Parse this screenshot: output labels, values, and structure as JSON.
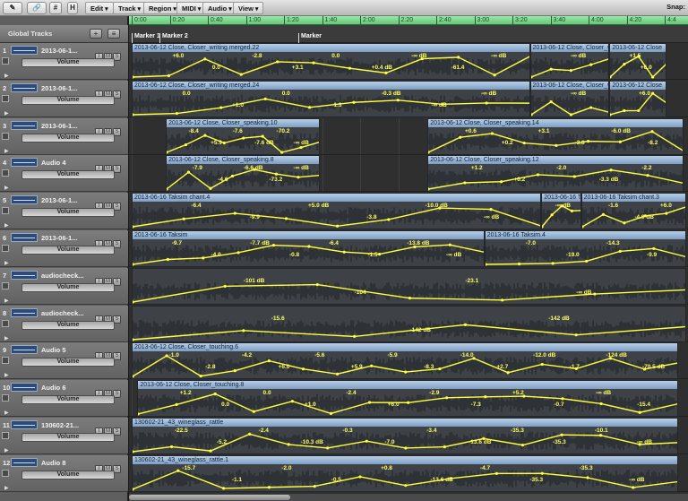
{
  "toolbar": {
    "buttons": [
      "✎",
      "🔗",
      "#",
      "H"
    ],
    "menus": [
      "Edit",
      "Track",
      "Region",
      "MIDI",
      "Audio",
      "View"
    ],
    "snap_label": "Snap:"
  },
  "global_tracks": {
    "label": "Global Tracks",
    "add": "+"
  },
  "ruler": {
    "ticks": [
      "0:00",
      "0:20",
      "0:40",
      "1:00",
      "1:20",
      "1:40",
      "2:00",
      "2:20",
      "2:40",
      "3:00",
      "3:20",
      "3:40",
      "4:00",
      "4:20",
      "4:4"
    ]
  },
  "markers": [
    {
      "label": "Marker 1",
      "pos": 0
    },
    {
      "label": "Marker 2",
      "pos": 0.5
    },
    {
      "label": "Marker",
      "pos": 3.0
    }
  ],
  "tracks": [
    {
      "num": "1",
      "name": "2013-06-1...",
      "param": "Volume",
      "regions": [
        {
          "title": "2013-06-12 Close, Closer_writing merged.22",
          "start": 0,
          "end": 3.5,
          "labels": [
            "+6.0",
            "0.0",
            "-2.8",
            "+3.1",
            "0.0",
            "+0.4 dB",
            "-∞ dB",
            "-61.4",
            "-∞ dB"
          ]
        },
        {
          "title": "2013-06-12 Close, Closer_writing me",
          "start": 3.5,
          "end": 4.2,
          "labels": [
            "-∞ dB"
          ]
        },
        {
          "title": "2013-06-12 Close",
          "start": 4.2,
          "end": 4.7,
          "labels": [
            "+1.5",
            "+6.0"
          ]
        }
      ]
    },
    {
      "num": "2",
      "name": "2013-06-1...",
      "param": "Volume",
      "regions": [
        {
          "title": "2013-06-12 Close, Closer_writing merged.24",
          "start": 0,
          "end": 3.5,
          "labels": [
            "0.0",
            "+1.0",
            "0.0",
            "-1.3",
            "-0.3 dB",
            "-∞ dB",
            "-∞ dB"
          ]
        },
        {
          "title": "2013-06-12 Close, Closer_writ",
          "start": 3.5,
          "end": 4.2,
          "labels": [
            "-∞ dB"
          ]
        },
        {
          "title": "2013-06-12 Close",
          "start": 4.2,
          "end": 4.7,
          "labels": [
            "+6.0"
          ]
        }
      ]
    },
    {
      "num": "3",
      "name": "2013-06-1...",
      "param": "Volume",
      "regions": [
        {
          "title": "2013-06-12 Close, Closer_speaking.10",
          "start": 0.3,
          "end": 1.65,
          "labels": [
            "-8.4",
            "+5.9",
            "-7.6",
            "-7.6 dB",
            "-70.2",
            "-∞ dB"
          ]
        },
        {
          "title": "2013-06-12 Close, Closer_speaking.14",
          "start": 2.6,
          "end": 4.85,
          "labels": [
            "+0.6",
            "+0.2",
            "+3.1",
            "-3.8",
            "-6.0 dB",
            "-8.2"
          ]
        }
      ]
    },
    {
      "num": "4",
      "name": "Audio 4",
      "param": "Volume",
      "regions": [
        {
          "title": "2013-06-12 Close, Closer_speaking.8",
          "start": 0.3,
          "end": 1.65,
          "labels": [
            "-7.9",
            "-4.6",
            "-6.6 dB",
            "-73.2",
            "-∞ dB"
          ]
        },
        {
          "title": "2013-06-12 Close, Closer_speaking.12",
          "start": 2.6,
          "end": 4.85,
          "labels": [
            "+1.2",
            "+0.2",
            "-2.0",
            "-3.3 dB",
            "-2.2"
          ]
        }
      ]
    },
    {
      "num": "5",
      "name": "2013-06-1...",
      "param": "Volume",
      "regions": [
        {
          "title": "2013-06-16 Taksim chant.4",
          "start": 0,
          "end": 3.6,
          "labels": [
            "-6.4",
            "-9.9",
            "+5.0 dB",
            "-3.8",
            "-10.0 dB",
            "-∞ dB"
          ]
        },
        {
          "title": "2013-06-16 T",
          "start": 3.6,
          "end": 3.95,
          "labels": [
            "-∞ dB"
          ]
        },
        {
          "title": "2013-06-16 Taksim chant.3",
          "start": 3.95,
          "end": 4.9,
          "labels": [
            "-1.6",
            "-4.9 dB",
            "+6.0"
          ]
        }
      ]
    },
    {
      "num": "6",
      "name": "2013-06-1...",
      "param": "Volume",
      "regions": [
        {
          "title": "2013-06-16 Taksim",
          "start": 0,
          "end": 3.1,
          "labels": [
            "-9.7",
            "-4.0",
            "-7.7 dB",
            "-0.8",
            "-6.4",
            "-1.5",
            "-13.8 dB",
            "-∞ dB"
          ]
        },
        {
          "title": "2013-06-16 Taksim.4",
          "start": 3.1,
          "end": 4.9,
          "labels": [
            "-7.0",
            "-19.0",
            "-14.3",
            "-9.9"
          ]
        }
      ]
    },
    {
      "num": "7",
      "name": "audiocheck...",
      "param": "Volume",
      "regions": [
        {
          "title": "",
          "start": 0,
          "end": 4.9,
          "labels": [
            "-101 dB",
            "-104",
            "-23.1",
            "-∞ dB"
          ]
        }
      ]
    },
    {
      "num": "8",
      "name": "audiocheck...",
      "param": "Volume",
      "regions": [
        {
          "title": "",
          "start": 0,
          "end": 4.9,
          "labels": [
            "-15.6",
            "-142 dB",
            "-142 dB"
          ]
        }
      ]
    },
    {
      "num": "9",
      "name": "Audio 5",
      "param": "Volume",
      "regions": [
        {
          "title": "2013-06-12 Close, Closer_touching.6",
          "start": 0,
          "end": 4.8,
          "labels": [
            "-1.0",
            "-2.8",
            "-4.2",
            "+6.0",
            "-5.6",
            "+5.9",
            "-5.9",
            "-8.3",
            "-14.0",
            "+2.7",
            "-12.0 dB",
            "-1.7",
            "-124 dB",
            "-70.5 dB"
          ]
        }
      ]
    },
    {
      "num": "10",
      "name": "Audio 6",
      "param": "Volume",
      "regions": [
        {
          "title": "2013-06-12 Close, Closer_touching.8",
          "start": 0.05,
          "end": 4.8,
          "labels": [
            "+1.2",
            "0.0",
            "0.0",
            "+1.0",
            "-2.4",
            "+6.0",
            "-2.9",
            "-7.3",
            "+5.2",
            "-0.7",
            "-∞ dB",
            "-15.4"
          ]
        }
      ]
    },
    {
      "num": "11",
      "name": "130602-21...",
      "param": "Volume",
      "regions": [
        {
          "title": "130602-21_43_wineglass_rattle",
          "start": 0,
          "end": 4.8,
          "labels": [
            "-22.5",
            "-5.2",
            "-2.4",
            "-10.3 dB",
            "-0.3",
            "-7.0",
            "-3.4",
            "-13.6 dB",
            "-35.3",
            "-35.3",
            "-10.1",
            "-∞ dB"
          ]
        }
      ]
    },
    {
      "num": "12",
      "name": "Audio 8",
      "param": "Volume",
      "regions": [
        {
          "title": "130602-21_43_wineglass_rattle.1",
          "start": 0,
          "end": 4.8,
          "labels": [
            "-15.7",
            "-1.1",
            "-2.0",
            "-0.5",
            "+0.8",
            "-13.6 dB",
            "-4.7",
            "-35.3",
            "-35.3",
            "-∞ dB"
          ]
        }
      ]
    }
  ],
  "colors": {
    "automation": "#ffff40",
    "region_title": "#9db8d8",
    "ruler": "#7fd690"
  }
}
